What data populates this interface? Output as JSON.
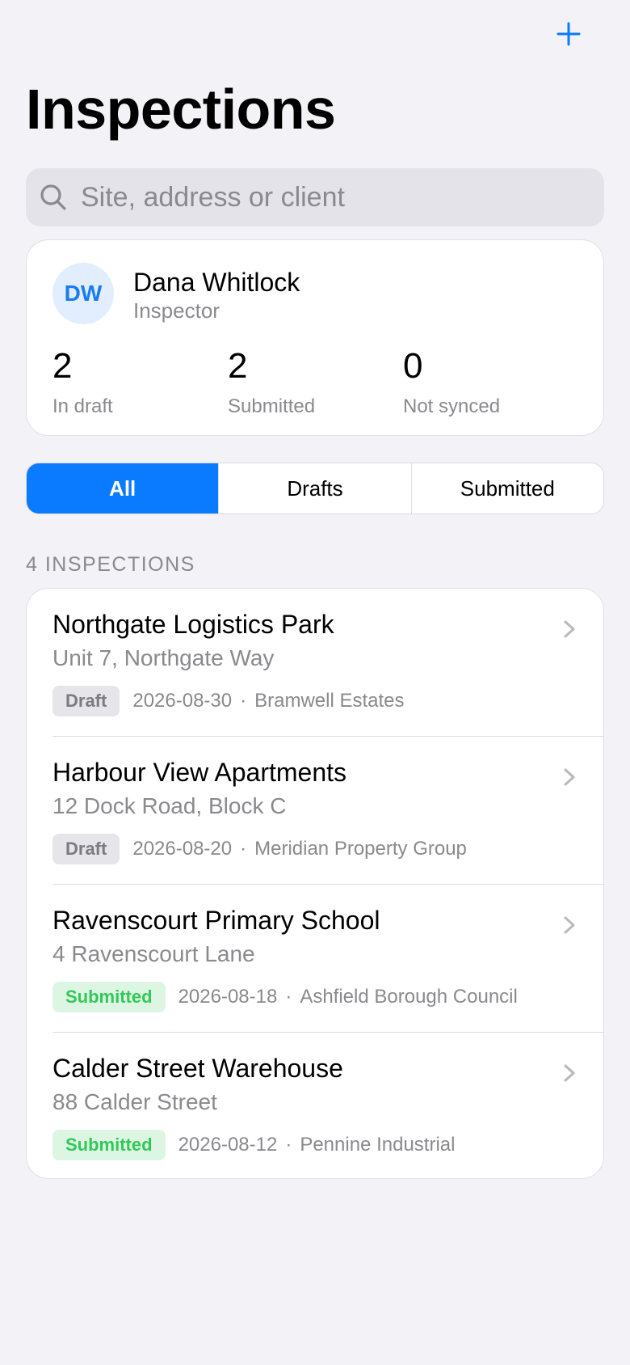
{
  "header": {
    "title": "Inspections",
    "add_icon": "plus-icon"
  },
  "search": {
    "placeholder": "Site, address or client",
    "value": ""
  },
  "profile": {
    "initials": "DW",
    "name": "Dana Whitlock",
    "role": "Inspector",
    "stats": [
      {
        "value": "2",
        "label": "In draft"
      },
      {
        "value": "2",
        "label": "Submitted"
      },
      {
        "value": "0",
        "label": "Not synced"
      }
    ]
  },
  "filter": {
    "options": [
      "All",
      "Drafts",
      "Submitted"
    ],
    "selected": "All"
  },
  "list": {
    "header": "4 INSPECTIONS",
    "items": [
      {
        "title": "Northgate Logistics Park",
        "address": "Unit 7, Northgate Way",
        "status": "Draft",
        "date": "2026-08-30",
        "client": "Bramwell Estates"
      },
      {
        "title": "Harbour View Apartments",
        "address": "12 Dock Road, Block C",
        "status": "Draft",
        "date": "2026-08-20",
        "client": "Meridian Property Group"
      },
      {
        "title": "Ravenscourt Primary School",
        "address": "4 Ravenscourt Lane",
        "status": "Submitted",
        "date": "2026-08-18",
        "client": "Ashfield Borough Council"
      },
      {
        "title": "Calder Street Warehouse",
        "address": "88 Calder Street",
        "status": "Submitted",
        "date": "2026-08-12",
        "client": "Pennine Industrial"
      }
    ]
  },
  "colors": {
    "accent": "#0A7AFF",
    "background": "#F2F2F7",
    "draft_badge": "#E5E5EA",
    "submitted_badge": "#DDF6E3",
    "submitted_text": "#34C759"
  }
}
